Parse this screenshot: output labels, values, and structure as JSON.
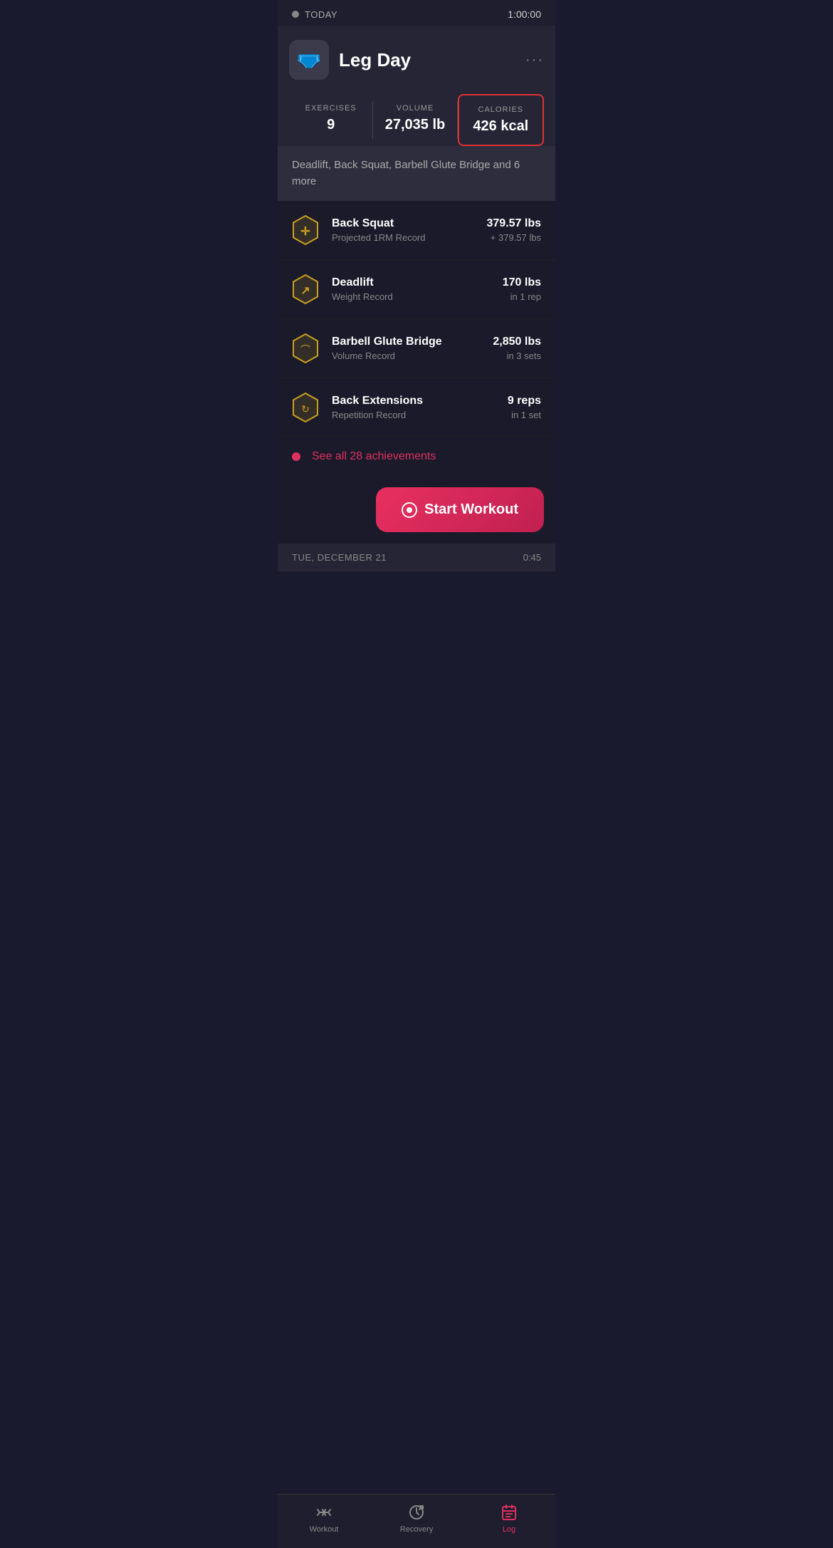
{
  "statusBar": {
    "label": "TODAY",
    "time": "1:00:00"
  },
  "workout": {
    "name": "Leg Day",
    "icon": "🩲",
    "moreDots": "···",
    "stats": {
      "exercises_label": "EXERCISES",
      "exercises_value": "9",
      "volume_label": "VOLUME",
      "volume_value": "27,035 lb",
      "calories_label": "CALORIES",
      "calories_value": "426 kcal"
    },
    "exercisePreview": "Deadlift, Back Squat, Barbell Glute Bridge and 6 more"
  },
  "achievements": [
    {
      "name": "Back Squat",
      "type": "Projected 1RM Record",
      "mainStat": "379.57 lbs",
      "subStat": "+ 379.57 lbs",
      "iconType": "arrows"
    },
    {
      "name": "Deadlift",
      "type": "Weight Record",
      "mainStat": "170 lbs",
      "subStat": "in 1 rep",
      "iconType": "arrows"
    },
    {
      "name": "Barbell Glute Bridge",
      "type": "Volume Record",
      "mainStat": "2,850 lbs",
      "subStat": "in 3 sets",
      "iconType": "dome"
    },
    {
      "name": "Back Extensions",
      "type": "Repetition Record",
      "mainStat": "9 reps",
      "subStat": "in 1 set",
      "iconType": "sync"
    }
  ],
  "seeAllText": "See all 28 achievements",
  "startWorkoutBtn": "Start Workout",
  "nextWorkout": {
    "label": "TUE, DECEMBER 21",
    "time": "0:45"
  },
  "bottomNav": {
    "items": [
      {
        "label": "Workout",
        "active": false,
        "icon": "dumbbell"
      },
      {
        "label": "Recovery",
        "active": false,
        "icon": "clock-refresh"
      },
      {
        "label": "Log",
        "active": true,
        "icon": "calendar"
      }
    ]
  }
}
